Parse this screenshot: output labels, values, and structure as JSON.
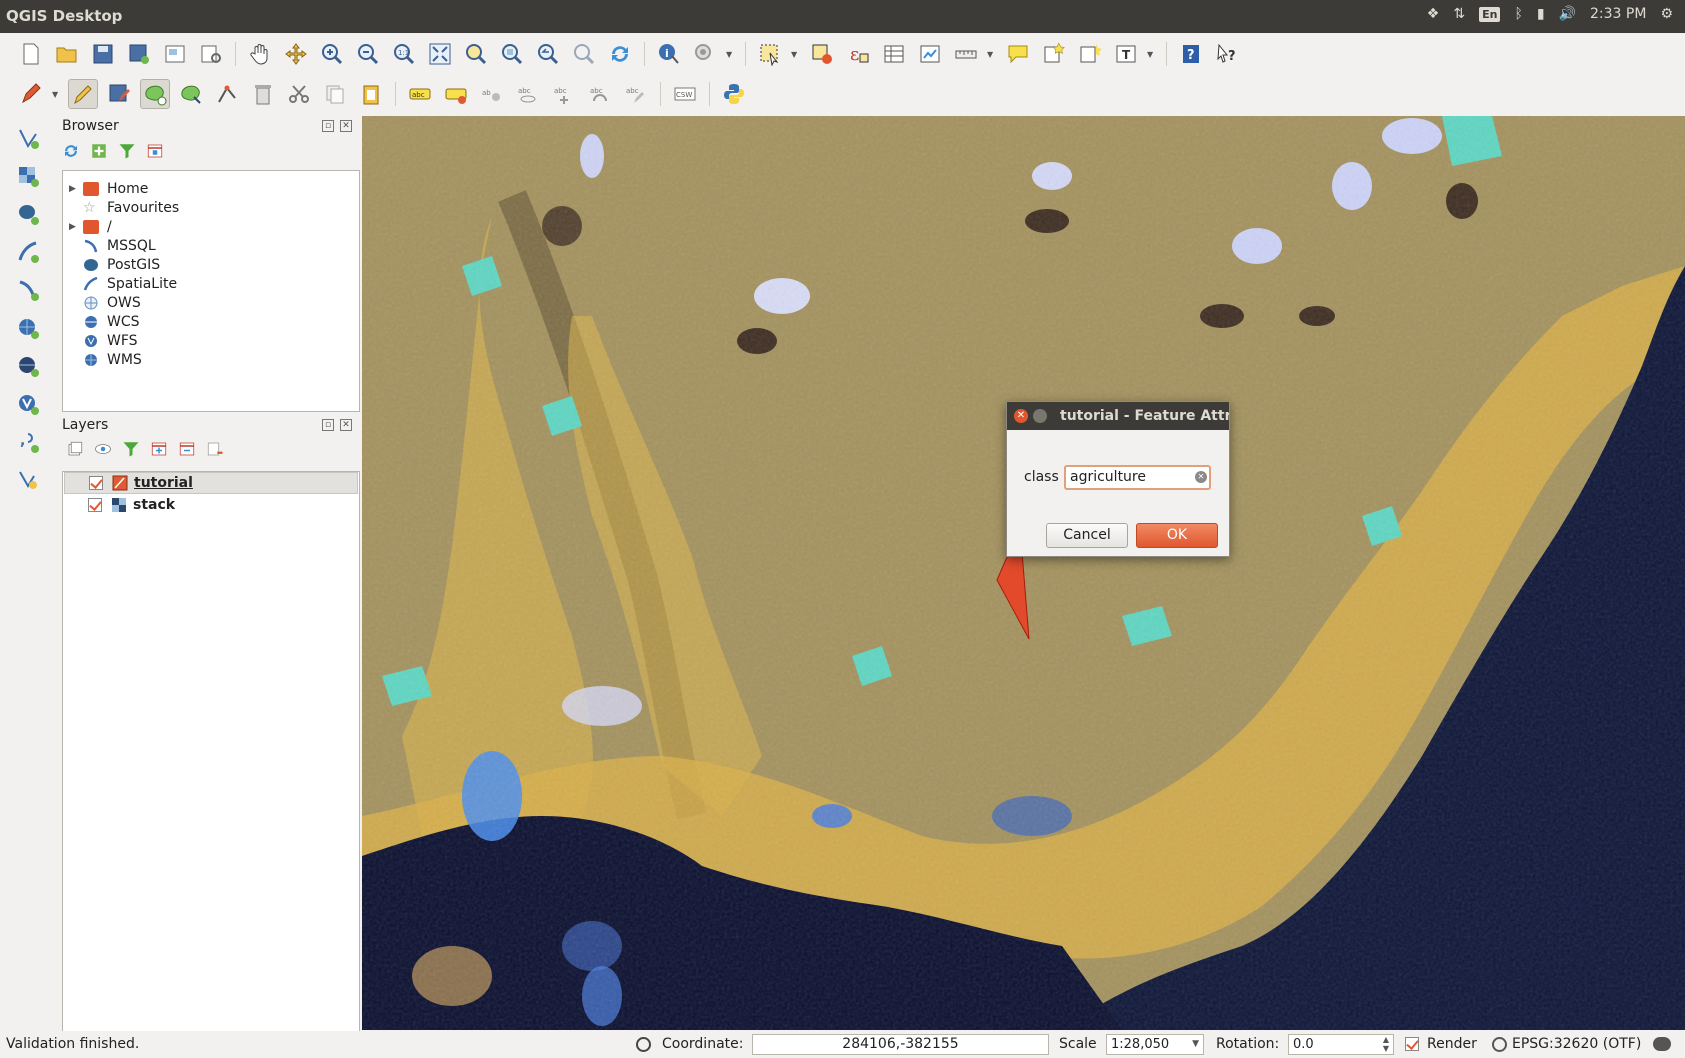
{
  "window": {
    "title": "QGIS Desktop"
  },
  "tray": {
    "lang": "En",
    "time": "2:33 PM"
  },
  "browser_panel": {
    "title": "Browser",
    "items": [
      {
        "label": "Home",
        "expandable": true,
        "icon": "folder-icon"
      },
      {
        "label": "Favourites",
        "expandable": false,
        "icon": "star-icon"
      },
      {
        "label": "/",
        "expandable": true,
        "icon": "folder-icon"
      },
      {
        "label": "MSSQL",
        "expandable": false,
        "icon": "mssql-icon"
      },
      {
        "label": "PostGIS",
        "expandable": false,
        "icon": "postgis-icon"
      },
      {
        "label": "SpatiaLite",
        "expandable": false,
        "icon": "spatialite-icon"
      },
      {
        "label": "OWS",
        "expandable": false,
        "icon": "ows-icon"
      },
      {
        "label": "WCS",
        "expandable": false,
        "icon": "wcs-icon"
      },
      {
        "label": "WFS",
        "expandable": false,
        "icon": "wfs-icon"
      },
      {
        "label": "WMS",
        "expandable": false,
        "icon": "wms-icon"
      }
    ]
  },
  "layers_panel": {
    "title": "Layers",
    "layers": [
      {
        "name": "tutorial",
        "checked": true,
        "selected": true,
        "icon": "vector-layer-icon"
      },
      {
        "name": "stack",
        "checked": true,
        "selected": false,
        "icon": "raster-layer-icon"
      }
    ]
  },
  "dialog": {
    "title": "tutorial - Feature Attributes",
    "field_label": "class",
    "field_value": "agriculture",
    "cancel_label": "Cancel",
    "ok_label": "OK"
  },
  "statusbar": {
    "message": "Validation finished.",
    "coordinate_label": "Coordinate:",
    "coordinate_value": "284106,-382155",
    "scale_label": "Scale",
    "scale_value": "1:28,050",
    "rotation_label": "Rotation:",
    "rotation_value": "0.0",
    "render_label": "Render",
    "render_checked": true,
    "crs_label": "EPSG:32620 (OTF)"
  },
  "colors": {
    "accent": "#e0572f",
    "titlebar": "#3c3b37",
    "panel_bg": "#f2f1f0",
    "map_land": "#a4925e",
    "map_water": "#0e1638",
    "polygon_fill": "#e34a2c"
  }
}
